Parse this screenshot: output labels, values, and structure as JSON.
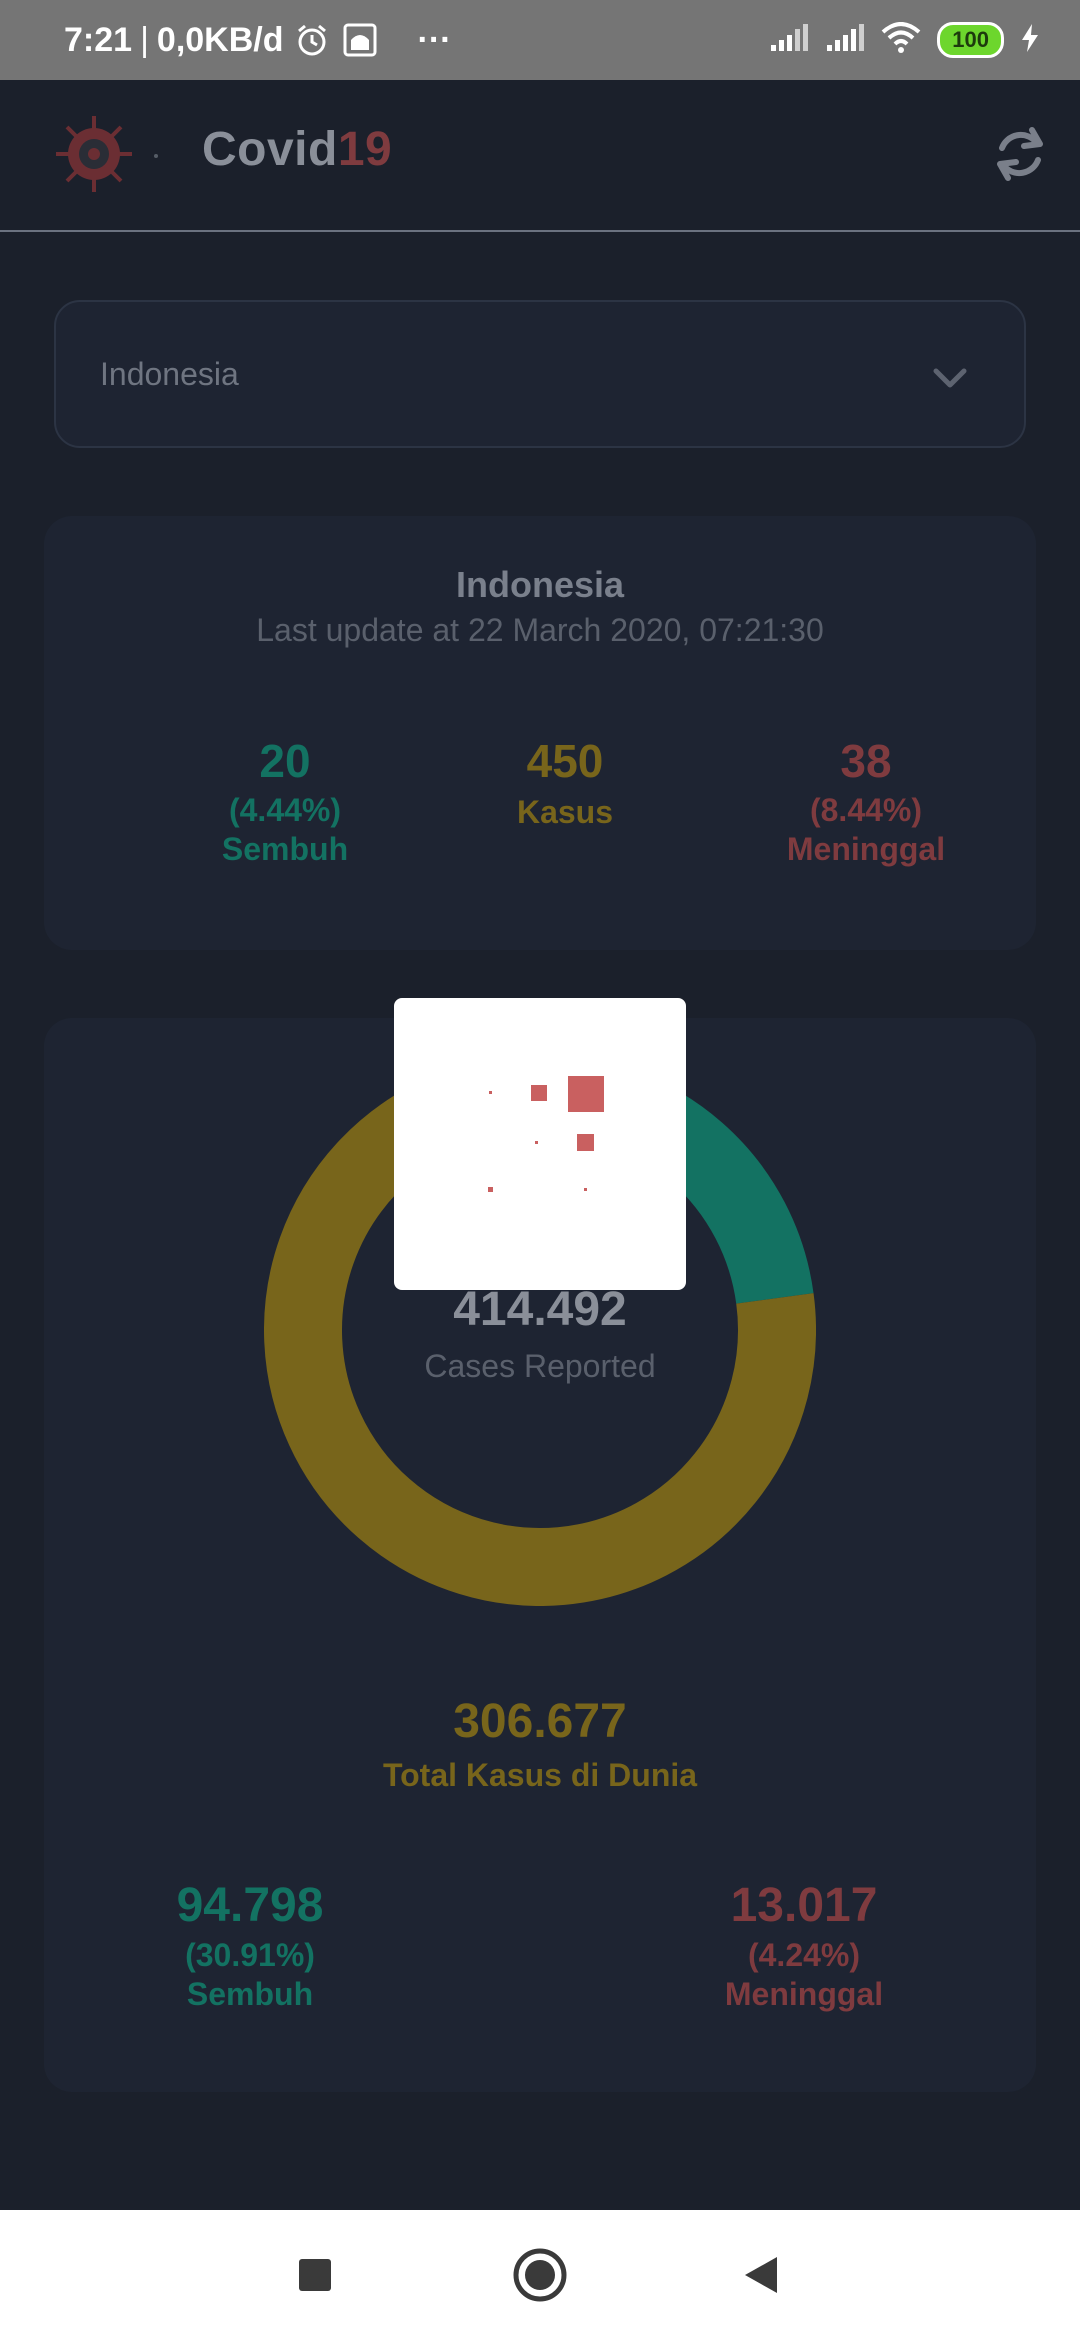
{
  "status_bar": {
    "time": "7:21",
    "separator": "|",
    "net_speed": "0,0KB/d",
    "more": "···",
    "battery": "100"
  },
  "app_bar": {
    "title_main": "Covid",
    "title_accent": "19",
    "icons": [
      "virus-logo-icon",
      "refresh-icon"
    ]
  },
  "country_select": {
    "selected": "Indonesia"
  },
  "country_card": {
    "name": "Indonesia",
    "last_update": "Last update at 22 March 2020, 07:21:30",
    "recovered": {
      "value": "20",
      "percent": "(4.44%)",
      "label": "Sembuh"
    },
    "cases": {
      "value": "450",
      "label": "Kasus"
    },
    "deaths": {
      "value": "38",
      "percent": "(8.44%)",
      "label": "Meninggal"
    }
  },
  "world_card": {
    "cases_reported_value": "414.492",
    "cases_reported_label": "Cases Reported",
    "total_value": "306.677",
    "total_label": "Total Kasus di Dunia",
    "recovered": {
      "value": "94.798",
      "percent": "(30.91%)",
      "label": "Sembuh"
    },
    "deaths": {
      "value": "13.017",
      "percent": "(4.24%)",
      "label": "Meninggal"
    }
  },
  "colors": {
    "background": "#1b202b",
    "card": "#1e2432",
    "green": "#137262",
    "yellow": "#78651b",
    "red": "#7f3b3f"
  },
  "chart_data": {
    "type": "pie",
    "categories": [
      "Sembuh",
      "Kasus"
    ],
    "values": [
      0.2287,
      0.7713
    ]
  }
}
